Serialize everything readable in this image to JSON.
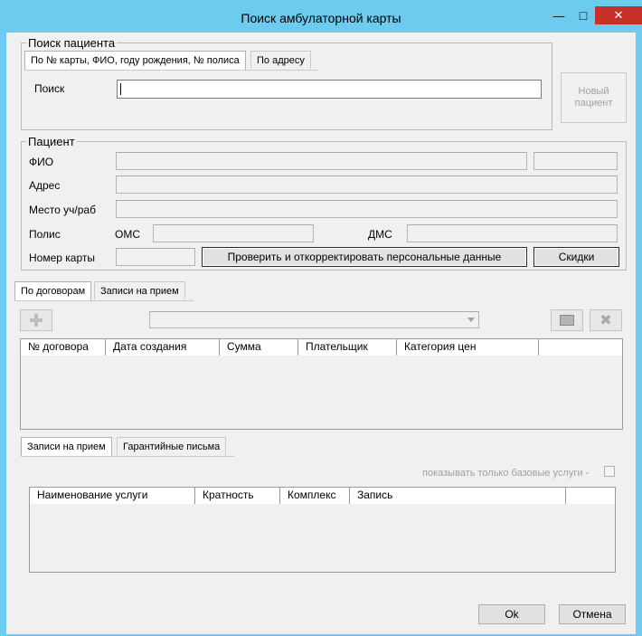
{
  "window": {
    "title": "Поиск амбулаторной карты",
    "minimize_glyph": "—",
    "maximize_glyph": "□",
    "close_glyph": "✕"
  },
  "search_group": {
    "legend": "Поиск пациента",
    "tabs": [
      "По № карты, ФИО, году рождения, № полиса",
      "По адресу"
    ],
    "search_label": "Поиск",
    "search_value": "",
    "new_patient_button": "Новый пациент"
  },
  "patient_group": {
    "legend": "Пациент",
    "fio_label": "ФИО",
    "address_label": "Адрес",
    "workplace_label": "Место уч/раб",
    "policy_label": "Полис",
    "oms_label": "ОМС",
    "dms_label": "ДМС",
    "card_number_label": "Номер карты",
    "verify_button": "Проверить и откорректировать персональные данные",
    "discounts_button": "Скидки"
  },
  "contracts_tabs": [
    "По договорам",
    "Записи на прием"
  ],
  "contracts_grid": {
    "columns": [
      "№ договора",
      "Дата создания",
      "Сумма",
      "Плательщик",
      "Категория цен",
      ""
    ]
  },
  "appointments_tabs": [
    "Записи на прием",
    "Гарантийные письма"
  ],
  "only_basic_services_label": "показывать только базовые услуги -",
  "services_grid": {
    "columns": [
      "Наименование услуги",
      "Кратность",
      "Комплекс",
      "Запись",
      ""
    ]
  },
  "footer": {
    "ok_button": "Ok",
    "cancel_button": "Отмена"
  },
  "colors": {
    "titlebar": "#6ccbee",
    "client_background": "#f0f0f0",
    "close_button": "#c7312a"
  }
}
